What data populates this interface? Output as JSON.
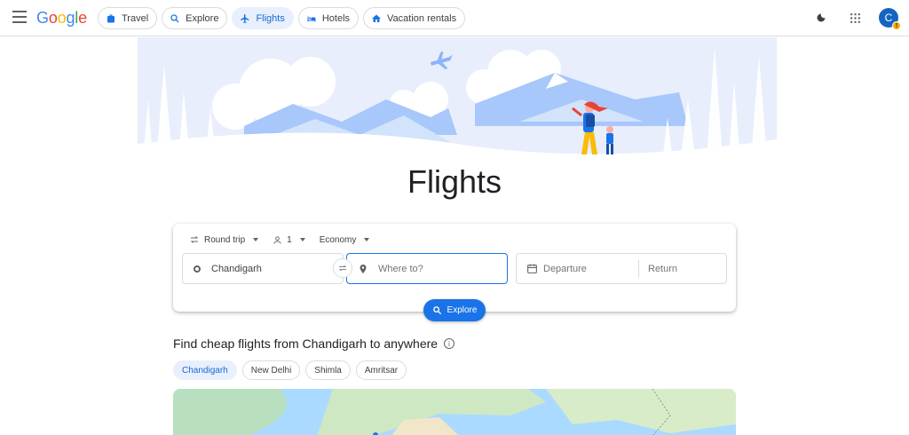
{
  "header": {
    "logo": {
      "G": "G",
      "o1": "o",
      "o2": "o",
      "g": "g",
      "l": "l",
      "e": "e"
    },
    "tabs": [
      {
        "label": "Travel",
        "icon": "suitcase-icon",
        "active": false
      },
      {
        "label": "Explore",
        "icon": "explore-icon",
        "active": false
      },
      {
        "label": "Flights",
        "icon": "airplane-icon",
        "active": true
      },
      {
        "label": "Hotels",
        "icon": "bed-icon",
        "active": false
      },
      {
        "label": "Vacation rentals",
        "icon": "house-icon",
        "active": false
      }
    ],
    "avatar_initial": "C"
  },
  "hero": {
    "title": "Flights"
  },
  "search": {
    "trip_type": "Round trip",
    "passengers": "1",
    "cabin": "Economy",
    "from_value": "Chandigarh",
    "to_placeholder": "Where to?",
    "departure_placeholder": "Departure",
    "return_placeholder": "Return",
    "explore_label": "Explore"
  },
  "cheap_flights": {
    "title": "Find cheap flights from Chandigarh to anywhere",
    "chips": [
      {
        "label": "Chandigarh",
        "active": true
      },
      {
        "label": "New Delhi",
        "active": false
      },
      {
        "label": "Shimla",
        "active": false
      },
      {
        "label": "Amritsar",
        "active": false
      }
    ]
  },
  "colors": {
    "accent": "#1a73e8",
    "active_bg": "#e8f0fe"
  }
}
